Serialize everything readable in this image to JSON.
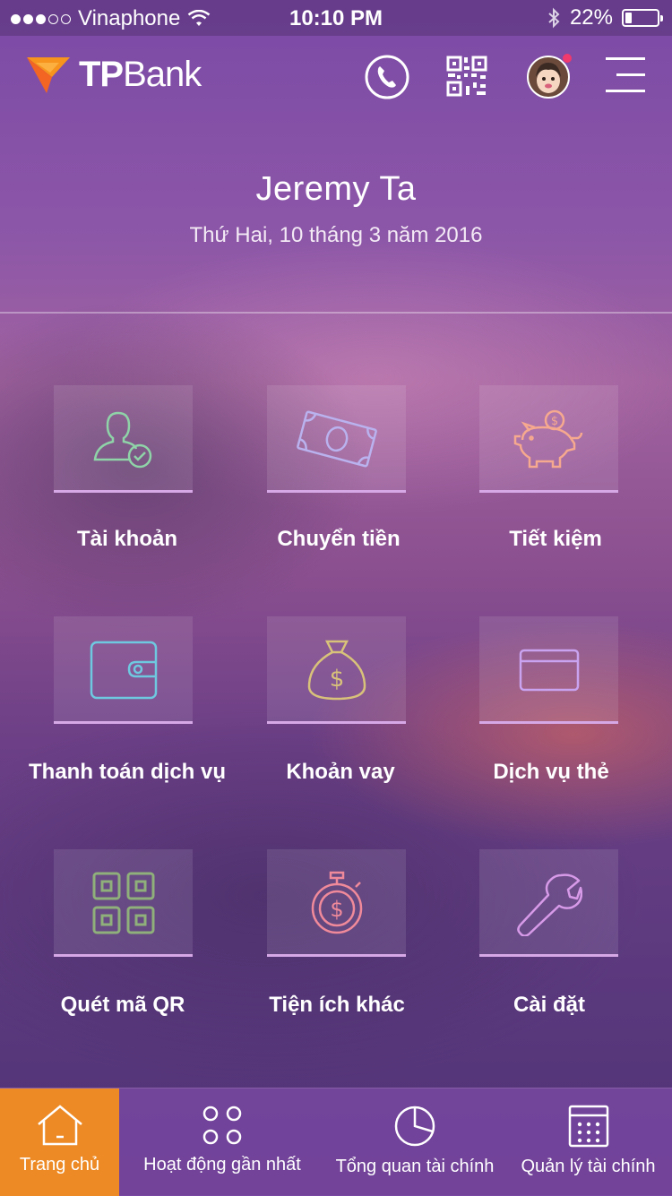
{
  "status_bar": {
    "carrier": "Vinaphone",
    "time": "10:10 PM",
    "battery": "22%",
    "battery_level": 0.22,
    "signal_bars_filled": 3,
    "signal_bars_total": 5
  },
  "header": {
    "logo_tp": "TP",
    "logo_bank": "Bank",
    "icons": [
      "phone-icon",
      "qr-code-icon",
      "avatar",
      "menu-icon"
    ]
  },
  "greeting": {
    "name": "Jeremy Ta",
    "date": "Thứ Hai, 10 tháng 3 năm 2016"
  },
  "tiles": [
    {
      "label": "Tài khoản",
      "icon": "account-icon",
      "color": "#8fd3a8"
    },
    {
      "label": "Chuyển tiền",
      "icon": "money-transfer-icon",
      "color": "#b9b2ee"
    },
    {
      "label": "Tiết kiệm",
      "icon": "piggy-bank-icon",
      "color": "#f6a98e"
    },
    {
      "label": "Thanh toán dịch vụ",
      "icon": "wallet-icon",
      "color": "#6ec9e0"
    },
    {
      "label": "Khoản vay",
      "icon": "money-bag-icon",
      "color": "#d8c27a"
    },
    {
      "label": "Dịch vụ thẻ",
      "icon": "card-icon",
      "color": "#c9a3f0"
    },
    {
      "label": "Quét mã QR",
      "icon": "qr-scan-icon",
      "color": "#8fb07a"
    },
    {
      "label": "Tiện ích khác",
      "icon": "stopwatch-dollar-icon",
      "color": "#f08a9a"
    },
    {
      "label": "Cài đặt",
      "icon": "wrench-icon",
      "color": "#d79ae8"
    }
  ],
  "bottom_nav": [
    {
      "label": "Trang chủ",
      "icon": "home-icon",
      "active": true
    },
    {
      "label": "Hoạt động gần nhất",
      "icon": "grid-dots-icon",
      "active": false
    },
    {
      "label": "Tổng quan tài chính",
      "icon": "pie-chart-icon",
      "active": false
    },
    {
      "label": "Quản lý tài chính",
      "icon": "calculator-icon",
      "active": false
    }
  ],
  "colors": {
    "active_nav": "#ed8a25",
    "tile_underline": "#d6a8e6",
    "logo_orange": "#f7941d"
  }
}
